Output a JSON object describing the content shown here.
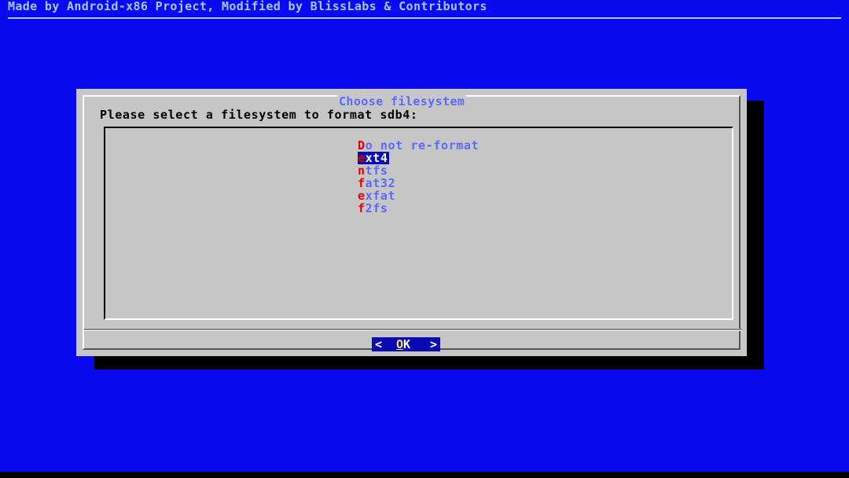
{
  "backtitle": "Made by Android-x86 Project, Modified by BlissLabs & Contributors",
  "dialog": {
    "title": "Choose filesystem",
    "prompt": "Please select a filesystem to format sdb4:",
    "items": [
      {
        "hotkey": "D",
        "rest": "o not re-format",
        "selected": false
      },
      {
        "hotkey": "e",
        "rest": "xt4",
        "selected": true
      },
      {
        "hotkey": "n",
        "rest": "tfs",
        "selected": false
      },
      {
        "hotkey": "f",
        "rest": "at32",
        "selected": false
      },
      {
        "hotkey": "e",
        "rest": "xfat",
        "selected": false
      },
      {
        "hotkey": "f",
        "rest": "2fs",
        "selected": false
      }
    ],
    "ok_button": {
      "left": "<",
      "hotkey": "O",
      "rest": "K",
      "right": ">"
    }
  },
  "colors": {
    "screen_bg": "#0a0af0",
    "dialog_bg": "#c6c6c6",
    "title_text": "#5a6aff",
    "hotkey": "#e00000",
    "selection_bg": "#0a0ab4"
  }
}
